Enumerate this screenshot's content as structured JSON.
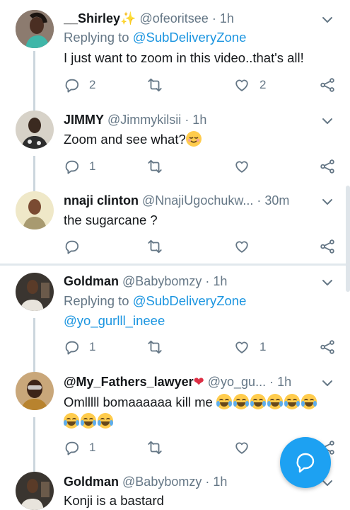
{
  "tweets": [
    {
      "name": "__Shirley",
      "name_suffix": "✨",
      "handle": "@ofeoritsee",
      "time": "· 1h",
      "replying_prefix": "Replying to ",
      "replying_to": "@SubDeliveryZone",
      "text": "I just want to zoom in this video..that's all!",
      "replies": "2",
      "retweets": "",
      "likes": "2"
    },
    {
      "name": "JIMMY",
      "handle": "@Jimmykilsii",
      "time": "· 1h",
      "text": "Zoom and see what?",
      "replies": "1",
      "retweets": "",
      "likes": ""
    },
    {
      "name": "nnaji clinton",
      "handle": "@NnajiUgochukw...",
      "time": "· 30m",
      "text": "the sugarcane ?",
      "replies": "",
      "retweets": "",
      "likes": ""
    },
    {
      "name": "Goldman",
      "handle": "@Babybomzy",
      "time": "· 1h",
      "replying_prefix": "Replying to ",
      "replying_to": "@SubDeliveryZone",
      "replying_to_2": "@yo_gurlll_ineee",
      "replies": "1",
      "retweets": "",
      "likes": "1"
    },
    {
      "name": "@My_Fathers_lawyer",
      "handle": "@yo_gu...",
      "time": "· 1h",
      "text": "Omlllll bomaaaaaa kill me",
      "replies": "1",
      "retweets": "",
      "likes": ""
    },
    {
      "name": "Goldman",
      "handle": "@Babybomzy",
      "time": "· 1h",
      "text": "Konji is a bastard"
    }
  ],
  "colors": {
    "accent": "#1da1f2",
    "link": "#1b95e0",
    "muted": "#657786",
    "heart": "#e0245e"
  },
  "icons": [
    "reply-icon",
    "retweet-icon",
    "like-icon",
    "share-icon",
    "chevron-down-icon",
    "compose-reply-icon"
  ]
}
